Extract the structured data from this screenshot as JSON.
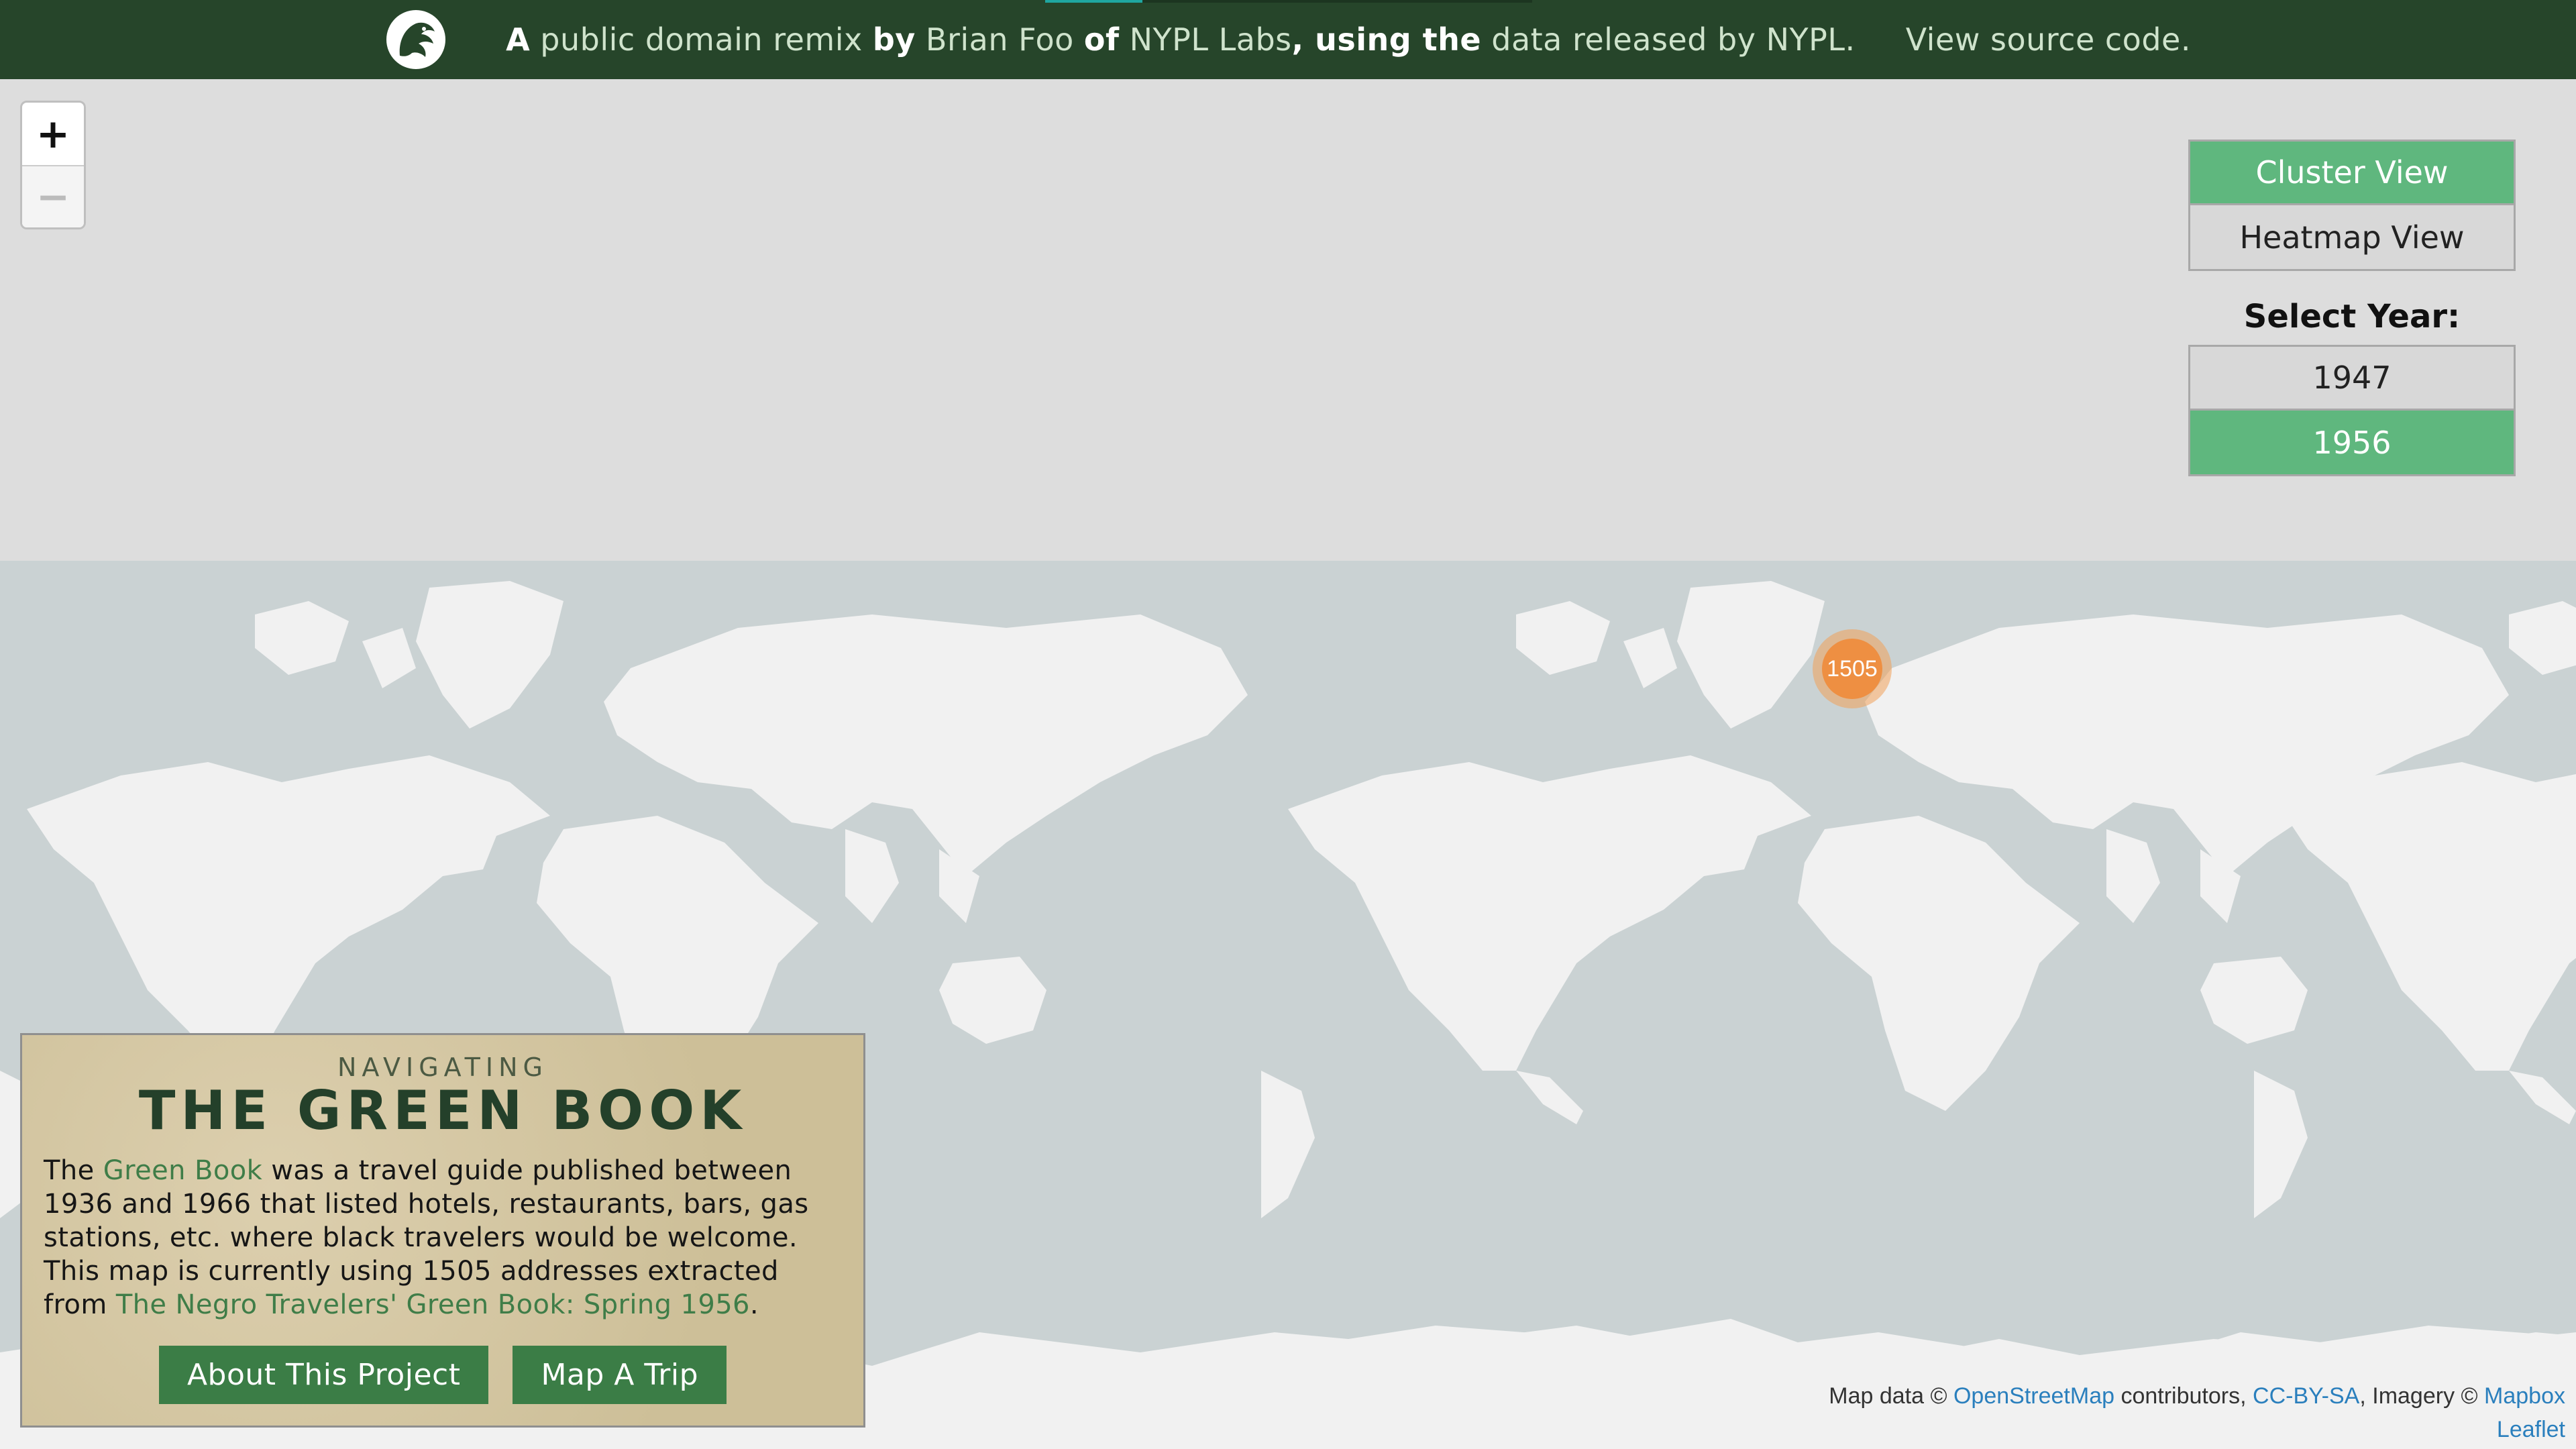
{
  "banner": {
    "prefix": "A",
    "link_public_domain": "public domain remix",
    "by": "by",
    "author": "Brian Foo",
    "of": "of",
    "lab": "NYPL Labs",
    "using": ", using the",
    "data_link": "data released by NYPL",
    "period": ".",
    "source_link": "View source code.",
    "progress": 0.2
  },
  "zoom": {
    "in": "+",
    "out": "−"
  },
  "views": {
    "cluster": "Cluster View",
    "heatmap": "Heatmap View",
    "active": "cluster"
  },
  "years": {
    "label": "Select Year:",
    "options": [
      "1947",
      "1956"
    ],
    "selected": "1956"
  },
  "marker": {
    "count": "1505"
  },
  "infobox": {
    "kicker": "NAVIGATING",
    "title": "THE GREEN BOOK",
    "desc_1": "The",
    "desc_link_1": "Green Book",
    "desc_2": "was a travel guide published between 1936 and 1966 that listed hotels, restaurants, bars, gas stations, etc. where black travelers would be welcome. This map is currently using 1505 addresses extracted from",
    "desc_link_2": "The Negro Travelers' Green Book: Spring 1956",
    "desc_3": ".",
    "btn_about": "About This Project",
    "btn_trip": "Map A Trip"
  },
  "attribution": {
    "map_data": "Map data ©",
    "osm": "OpenStreetMap",
    "contributors": "contributors,",
    "license": "CC-BY-SA",
    "imagery": ", Imagery ©",
    "mapbox": "Mapbox",
    "leaflet": "Leaflet"
  },
  "colors": {
    "banner_bg": "#26452a",
    "ocean": "#cad2d3",
    "land": "#f1f1f1",
    "active_green": "#5fb77e",
    "marker_orange": "#ee8f42"
  }
}
